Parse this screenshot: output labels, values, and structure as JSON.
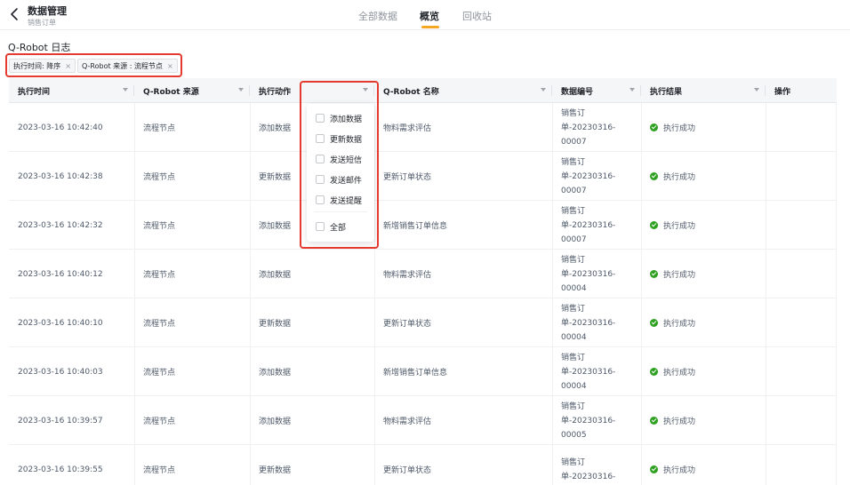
{
  "header": {
    "title": "数据管理",
    "subtitle": "销售订单",
    "tabs": [
      {
        "label": "全部数据",
        "active": false
      },
      {
        "label": "概览",
        "active": true
      },
      {
        "label": "回收站",
        "active": false
      }
    ]
  },
  "log": {
    "title": "Q-Robot 日志",
    "filters": [
      {
        "label": "执行时间: 降序",
        "close": "×"
      },
      {
        "label": "Q-Robot 来源 : 流程节点",
        "close": "×"
      }
    ]
  },
  "table": {
    "columns": [
      "执行时间",
      "Q-Robot 来源",
      "执行动作",
      "",
      "Q-Robot 名称",
      "数据编号",
      "执行结果",
      "操作"
    ],
    "rows": [
      {
        "time": "2023-03-16 10:42:40",
        "source": "流程节点",
        "action": "添加数据",
        "name": "物料需求评估",
        "num": "销售订单-20230316-00007",
        "result": "执行成功"
      },
      {
        "time": "2023-03-16 10:42:38",
        "source": "流程节点",
        "action": "更新数据",
        "name": "更新订单状态",
        "num": "销售订单-20230316-00007",
        "result": "执行成功"
      },
      {
        "time": "2023-03-16 10:42:32",
        "source": "流程节点",
        "action": "添加数据",
        "name": "新增销售订单信息",
        "num": "销售订单-20230316-00007",
        "result": "执行成功"
      },
      {
        "time": "2023-03-16 10:40:12",
        "source": "流程节点",
        "action": "添加数据",
        "name": "物料需求评估",
        "num": "销售订单-20230316-00004",
        "result": "执行成功"
      },
      {
        "time": "2023-03-16 10:40:10",
        "source": "流程节点",
        "action": "更新数据",
        "name": "更新订单状态",
        "num": "销售订单-20230316-00004",
        "result": "执行成功"
      },
      {
        "time": "2023-03-16 10:40:03",
        "source": "流程节点",
        "action": "添加数据",
        "name": "新增销售订单信息",
        "num": "销售订单-20230316-00004",
        "result": "执行成功"
      },
      {
        "time": "2023-03-16 10:39:57",
        "source": "流程节点",
        "action": "添加数据",
        "name": "物料需求评估",
        "num": "销售订单-20230316-00005",
        "result": "执行成功"
      },
      {
        "time": "2023-03-16 10:39:55",
        "source": "流程节点",
        "action": "更新数据",
        "name": "更新订单状态",
        "num": "销售订单-20230316-",
        "result": "执行成功"
      }
    ]
  },
  "action_filter": {
    "options": [
      "添加数据",
      "更新数据",
      "发送短信",
      "发送邮件",
      "发送提醒"
    ],
    "all_label": "全部"
  }
}
